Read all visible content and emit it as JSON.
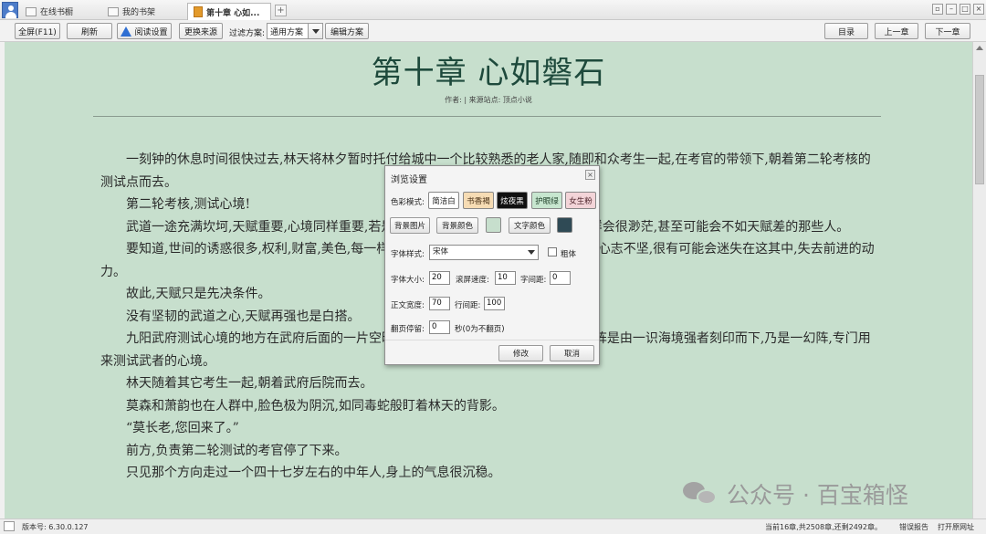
{
  "tabs": [
    {
      "label": "在线书橱",
      "active": false
    },
    {
      "label": "我的书架",
      "active": false
    },
    {
      "label": "第十章 心如...",
      "active": true
    }
  ],
  "new_tab_label": "+",
  "toolbar": {
    "fullscreen": "全屏(F11)",
    "refresh": "刷新",
    "reading_settings": "阅读设置",
    "change_source": "更换来源",
    "filter_label": "过滤方案:",
    "filter_value": "通用方案",
    "edit_scheme": "编辑方案",
    "toc": "目录",
    "prev_chapter": "上一章",
    "next_chapter": "下一章"
  },
  "chapter": {
    "title": "第十章 心如磐石",
    "meta": "作者: | 来源站点: 顶点小说",
    "paragraphs": [
      "一刻钟的休息时间很快过去,林天将林夕暂时托付给城中一个比较熟悉的老人家,随即和众考生一起,在考官的带领下,朝着第二轮考核的测试点而去。",
      "第二轮考核,测试心境!",
      "武道一途充满坎坷,天赋重要,心境同样重要,若是没有坚定的心志,未来的武道成就一样会很渺茫,甚至可能会不如天赋差的那些人。",
      "要知道,世间的诱惑很多,权利,财富,美色,每一样对于武者而言都可能是致命性的,若是心志不坚,很有可能会迷失在这其中,失去前进的动力。",
      "故此,天赋只是先决条件。",
      "没有坚韧的武道之心,天赋再强也是白搭。",
      "九阳武府测试心境的地方在武府后面的一片空旷庭院内,庭院最中央有着一座大阵,大阵是由一识海境强者刻印而下,乃是一幻阵,专门用来测试武者的心境。",
      "林天随着其它考生一起,朝着武府后院而去。",
      "莫森和萧韵也在人群中,脸色极为阴沉,如同毒蛇般盯着林天的背影。",
      "“莫长老,您回来了。”",
      "前方,负责第二轮测试的考官停了下来。",
      "只见那个方向走过一个四十七岁左右的中年人,身上的气息很沉稳。"
    ]
  },
  "dialog": {
    "title": "浏览设置",
    "color_mode_label": "色彩模式:",
    "modes": [
      {
        "label": "简洁白",
        "bg": "#ffffff",
        "fg": "#222222"
      },
      {
        "label": "书香褐",
        "bg": "#f6dcb4",
        "fg": "#4a3218"
      },
      {
        "label": "炫夜黑",
        "bg": "#111111",
        "fg": "#ffffff"
      },
      {
        "label": "护眼绿",
        "bg": "#c7e6cf",
        "fg": "#1d3d27"
      },
      {
        "label": "女生粉",
        "bg": "#f3d4d8",
        "fg": "#4b2128"
      }
    ],
    "bg_image_btn": "背景图片",
    "bg_color_btn": "背景颜色",
    "bg_color": "#c7dfcd",
    "text_color_btn": "文字颜色",
    "text_color": "#2f4a55",
    "font_style_label": "字体样式:",
    "font_value": "宋体",
    "bold_label": "粗体",
    "font_size_label": "字体大小:",
    "font_size_value": "20",
    "scroll_speed_label": "滚屏速度:",
    "scroll_speed_value": "10",
    "letter_spacing_label": "字间距:",
    "letter_spacing_value": "0",
    "body_width_label": "正文宽度:",
    "body_width_value": "70",
    "line_spacing_label": "行间距:",
    "line_spacing_value": "100",
    "page_stay_label": "翻页停留:",
    "page_stay_value": "0",
    "page_stay_unit": "秒(0为不翻页)",
    "ok_btn": "修改",
    "cancel_btn": "取消"
  },
  "status": {
    "version": "版本号: 6.30.0.127",
    "progress": "当前16章,共2508章,还剩2492章。",
    "report": "错误报告",
    "open_url": "打开原网址"
  },
  "watermark": "公众号 · 百宝箱怪",
  "colors": {
    "reader_bg": "#c7dfcd",
    "title": "#1e4a3c"
  }
}
